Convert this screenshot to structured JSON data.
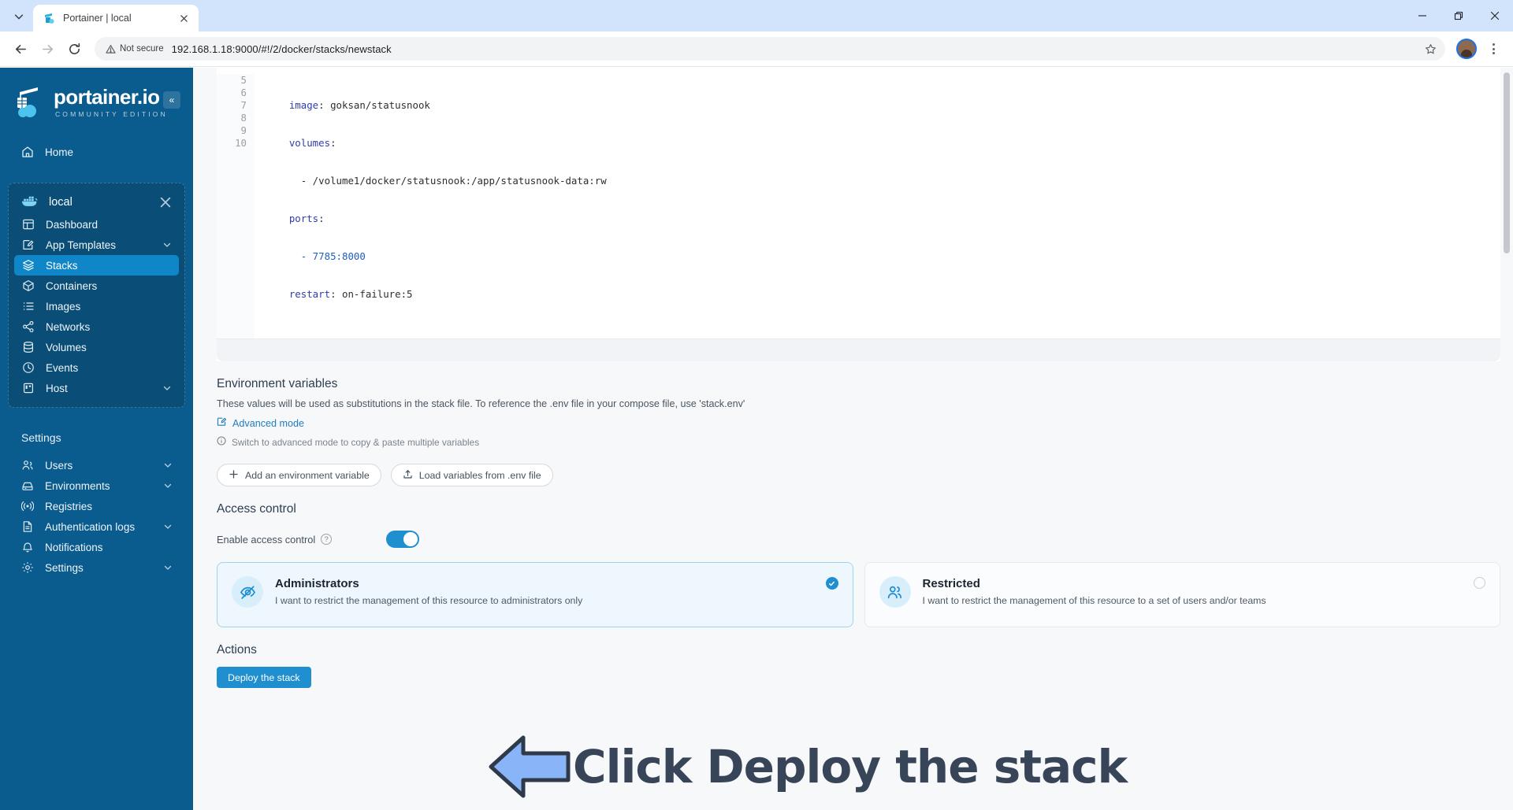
{
  "browser": {
    "tab": {
      "title": "Portainer | local",
      "favicon": "portainer-favicon-icon"
    },
    "security_label": "Not secure",
    "url": "192.168.1.18:9000/#!/2/docker/stacks/newstack",
    "window_controls": {
      "minimize": "minimize-icon",
      "restore": "restore-icon",
      "close": "close-icon"
    }
  },
  "sidebar": {
    "logo": {
      "title": "portainer.io",
      "subtitle": "COMMUNITY EDITION"
    },
    "collapse_label": "«",
    "home": {
      "label": "Home",
      "icon": "home-icon"
    },
    "environment": {
      "name": "local",
      "icon": "docker-icon",
      "close_icon": "close-icon"
    },
    "env_items": [
      {
        "label": "Dashboard",
        "icon": "dashboard-icon",
        "active": false,
        "caret": false
      },
      {
        "label": "App Templates",
        "icon": "templates-icon",
        "active": false,
        "caret": true
      },
      {
        "label": "Stacks",
        "icon": "stacks-icon",
        "active": true,
        "caret": false
      },
      {
        "label": "Containers",
        "icon": "containers-icon",
        "active": false,
        "caret": false
      },
      {
        "label": "Images",
        "icon": "images-icon",
        "active": false,
        "caret": false
      },
      {
        "label": "Networks",
        "icon": "networks-icon",
        "active": false,
        "caret": false
      },
      {
        "label": "Volumes",
        "icon": "volumes-icon",
        "active": false,
        "caret": false
      },
      {
        "label": "Events",
        "icon": "events-icon",
        "active": false,
        "caret": false
      },
      {
        "label": "Host",
        "icon": "host-icon",
        "active": false,
        "caret": true
      }
    ],
    "settings_title": "Settings",
    "settings_items": [
      {
        "label": "Users",
        "icon": "users-icon",
        "caret": true
      },
      {
        "label": "Environments",
        "icon": "environments-icon",
        "caret": true
      },
      {
        "label": "Registries",
        "icon": "registries-icon",
        "caret": false
      },
      {
        "label": "Authentication logs",
        "icon": "auth-logs-icon",
        "caret": true
      },
      {
        "label": "Notifications",
        "icon": "notifications-icon",
        "caret": false
      },
      {
        "label": "Settings",
        "icon": "gear-icon",
        "caret": true
      }
    ]
  },
  "editor": {
    "lines": [
      {
        "num": "5",
        "indent": 4,
        "key": "image",
        "sep": ": ",
        "value": "goksan/statusnook",
        "type": "plain"
      },
      {
        "num": "6",
        "indent": 4,
        "key": "volumes",
        "sep": ":",
        "value": "",
        "type": "plain"
      },
      {
        "num": "7",
        "indent": 6,
        "key": "",
        "sep": "",
        "value": "- /volume1/docker/statusnook:/app/statusnook-data:rw",
        "type": "plain"
      },
      {
        "num": "8",
        "indent": 4,
        "key": "ports",
        "sep": ":",
        "value": "",
        "type": "plain"
      },
      {
        "num": "9",
        "indent": 6,
        "key": "",
        "sep": "",
        "value": "- 7785:8000",
        "type": "num"
      },
      {
        "num": "10",
        "indent": 4,
        "key": "restart",
        "sep": ": ",
        "value": "on-failure:5",
        "type": "mixed"
      }
    ]
  },
  "env_section": {
    "title": "Environment variables",
    "description": "These values will be used as substitutions in the stack file. To reference the .env file in your compose file, use 'stack.env'",
    "advanced_mode_label": "Advanced mode",
    "advanced_mode_icon": "edit-icon",
    "hint": "Switch to advanced mode to copy & paste multiple variables",
    "hint_icon": "info-icon",
    "add_variable_label": "Add an environment variable",
    "add_variable_icon": "plus-icon",
    "load_env_label": "Load variables from .env file",
    "load_env_icon": "upload-icon"
  },
  "access_control": {
    "title": "Access control",
    "toggle_label": "Enable access control",
    "toggle_help_icon": "question-icon",
    "toggle_on": true,
    "options": [
      {
        "title": "Administrators",
        "subtitle": "I want to restrict the management of this resource to administrators only",
        "icon": "eye-off-icon",
        "selected": true
      },
      {
        "title": "Restricted",
        "subtitle": "I want to restrict the management of this resource to a set of users and/or teams",
        "icon": "users-group-icon",
        "selected": false
      }
    ]
  },
  "actions": {
    "title": "Actions",
    "deploy_label": "Deploy the stack"
  },
  "annotation": {
    "text": "Click Deploy the stack",
    "arrow_icon": "left-arrow-annotation-icon",
    "arrow_fill": "#8ab4f8",
    "arrow_stroke": "#2e3a4a",
    "text_color": "#384559"
  },
  "colors": {
    "sidebar_bg": "#0b5c8e",
    "sidebar_group_bg": "#0a4e78",
    "accent": "#1f8fd0",
    "active_item": "#0f86c7",
    "page_bg": "#f7f8fa"
  }
}
